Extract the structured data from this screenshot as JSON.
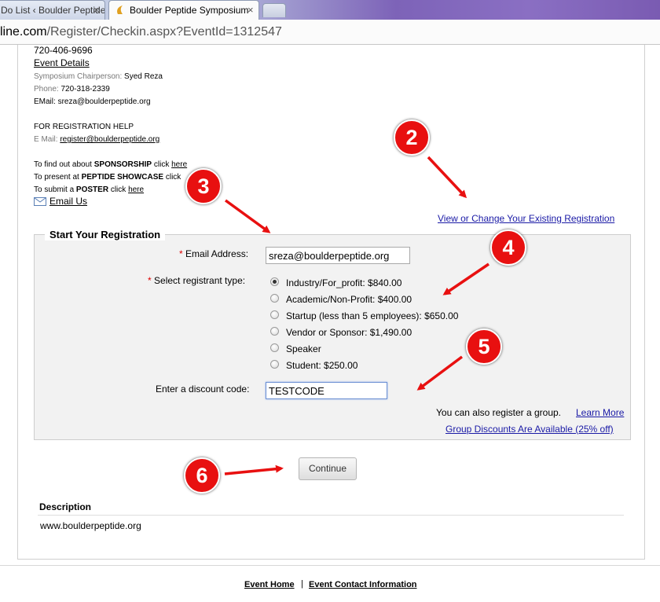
{
  "browser": {
    "tabs": [
      {
        "label": "Do List ‹ Boulder Peptide",
        "close": "×"
      },
      {
        "label": "Boulder Peptide Symposium",
        "close": "×"
      }
    ],
    "url_domain": "line.com",
    "url_path": "/Register/Checkin.aspx?EventId=1312547"
  },
  "info": {
    "phone_top": "720-406-9696",
    "event_details": "Event Details",
    "chair_label": "Symposium Chairperson:",
    "chair_name": "Syed Reza",
    "phone_label": "Phone:",
    "phone_value": "720-318-2339",
    "email_label": "EMail:",
    "email_value": "sreza@boulderpeptide.org",
    "help_heading": "FOR REGISTRATION HELP",
    "help_email_label": "E Mail:",
    "help_email": "register@boulderpeptide.org",
    "sponsor_pre": "To find out about",
    "sponsor_word": "SPONSORSHIP",
    "sponsor_post": "click",
    "sponsor_link": "here",
    "showcase_pre": "To present at",
    "showcase_word": "PEPTIDE SHOWCASE",
    "showcase_post": "click",
    "poster_pre": "To submit a",
    "poster_word": "POSTER",
    "poster_post": "click",
    "poster_link": "here",
    "email_us": "Email Us"
  },
  "existing_link": "View or Change Your Existing Registration",
  "form": {
    "legend": "Start Your Registration",
    "email_label": "Email Address:",
    "email_value": "sreza@boulderpeptide.org",
    "type_label": "Select registrant type:",
    "types": [
      "Industry/For_profit: $840.00",
      "Academic/Non-Profit: $400.00",
      "Startup (less than 5 employees): $650.00",
      "Vendor or Sponsor: $1,490.00",
      "Speaker",
      "Student: $250.00"
    ],
    "selected_type_index": 0,
    "discount_label": "Enter a discount code:",
    "discount_value": "TESTCODE",
    "group_text": "You can also register a group.",
    "learn_more": "Learn More",
    "group_discounts": "Group Discounts Are Available (25% off)",
    "continue": "Continue",
    "required_mark": "*"
  },
  "description": {
    "heading": "Description",
    "text": "www.boulderpeptide.org"
  },
  "footer": {
    "event_home": "Event Home",
    "divider": "|",
    "contact": "Event Contact Information"
  },
  "annotations": [
    "2",
    "3",
    "4",
    "5",
    "6"
  ],
  "colors": {
    "badge": "#e81010",
    "arrow": "#e81010",
    "link_blue": "#1a1aa6"
  }
}
